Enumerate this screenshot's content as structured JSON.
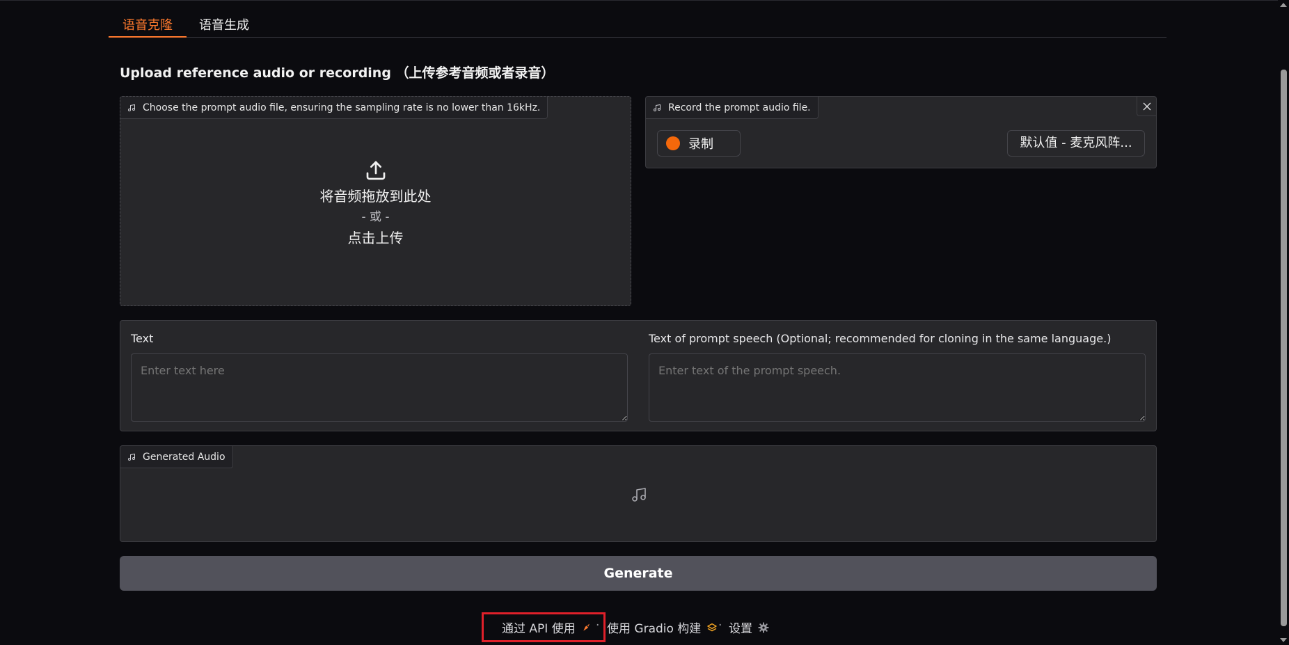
{
  "tabs": [
    {
      "label": "语音克隆",
      "active": true
    },
    {
      "label": "语音生成",
      "active": false
    }
  ],
  "section_title": "Upload reference audio or recording （上传参考音频或者录音）",
  "upload": {
    "label": "Choose the prompt audio file, ensuring the sampling rate is no lower than 16kHz.",
    "drop_text": "将音频拖放到此处",
    "or_text": "- 或 -",
    "click_text": "点击上传",
    "icon": "upload-icon"
  },
  "record": {
    "label": "Record the prompt audio file.",
    "record_button": "录制",
    "mic_select": "默认值 - 麦克风阵...",
    "record_color": "#f4680b"
  },
  "text_block": {
    "text_label": "Text",
    "text_placeholder": "Enter text here",
    "prompt_label": "Text of prompt speech (Optional; recommended for cloning in the same language.)",
    "prompt_placeholder": "Enter text of the prompt speech."
  },
  "generated": {
    "label": "Generated Audio",
    "icon": "music-note-icon"
  },
  "generate_button": "Generate",
  "footer": {
    "api": "通过 API 使用",
    "gradio": "使用 Gradio 构建",
    "settings": "设置",
    "separator": "·",
    "highlight_color": "#e0202a"
  },
  "colors": {
    "accent": "#ff7a2e",
    "background": "#0b0b0f",
    "panel": "#27272a"
  }
}
